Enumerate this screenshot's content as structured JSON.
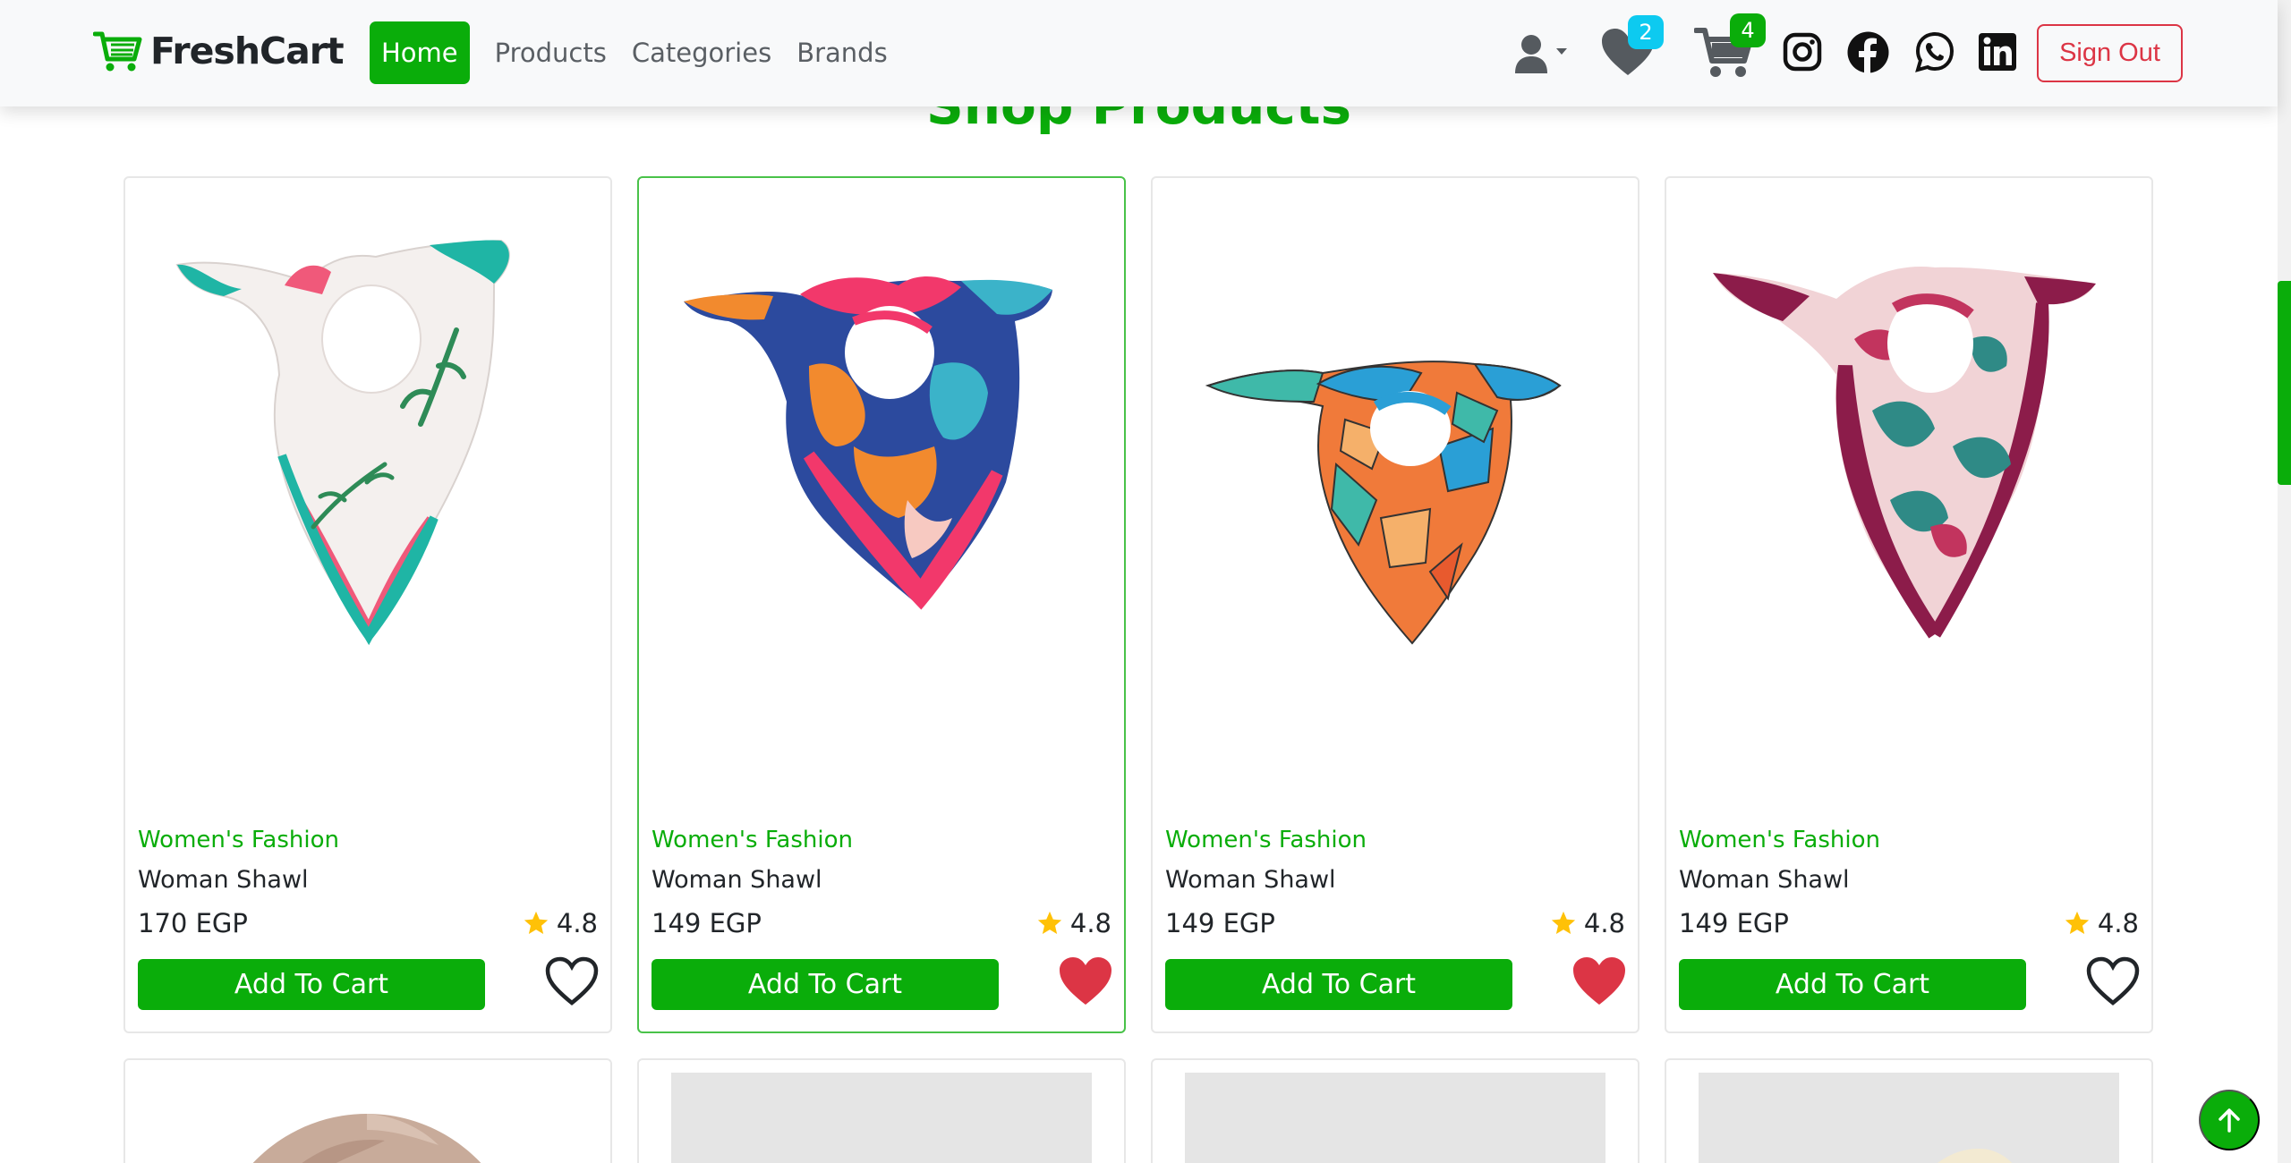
{
  "navbar": {
    "brand": "FreshCart",
    "links": [
      {
        "label": "Home",
        "active": true
      },
      {
        "label": "Products",
        "active": false
      },
      {
        "label": "Categories",
        "active": false
      },
      {
        "label": "Brands",
        "active": false
      }
    ],
    "wishlist_count": "2",
    "cart_count": "4",
    "social_icons": [
      "instagram-icon",
      "facebook-icon",
      "whatsapp-icon",
      "linkedin-icon"
    ],
    "signout_label": "Sign Out"
  },
  "main": {
    "title": "Shop Products",
    "products": [
      {
        "category": "Women's Fashion",
        "name": "Woman Shawl",
        "price": "170 EGP",
        "rating": "4.8",
        "wishlisted": false,
        "button": "Add To Cart",
        "palette": [
          "#f4f0ee",
          "#1fb5a5",
          "#2e8b57",
          "#f0597a"
        ]
      },
      {
        "category": "Women's Fashion",
        "name": "Woman Shawl",
        "price": "149 EGP",
        "rating": "4.8",
        "wishlisted": true,
        "button": "Add To Cart",
        "palette": [
          "#2c4a9e",
          "#f2386b",
          "#f28a2e",
          "#3bb3c9"
        ]
      },
      {
        "category": "Women's Fashion",
        "name": "Woman Shawl",
        "price": "149 EGP",
        "rating": "4.8",
        "wishlisted": true,
        "button": "Add To Cart",
        "palette": [
          "#2a9fd6",
          "#f07a3a",
          "#3fb9a9",
          "#e85a2e"
        ]
      },
      {
        "category": "Women's Fashion",
        "name": "Woman Shawl",
        "price": "149 EGP",
        "rating": "4.8",
        "wishlisted": false,
        "button": "Add To Cart",
        "palette": [
          "#f1d3d6",
          "#8c1c4a",
          "#2f8a86",
          "#c2345e"
        ]
      }
    ]
  },
  "colors": {
    "accent": "#0aad0a",
    "danger": "#dc3545",
    "info": "#0dcaf0",
    "star": "#ffc107"
  }
}
